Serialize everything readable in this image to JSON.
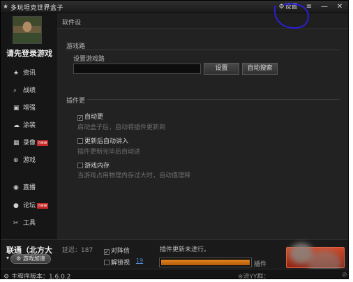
{
  "window": {
    "title": "多玩坦克世界盒子",
    "settings_label": "设置",
    "skin_symbol": "≡",
    "minimize_symbol": "—",
    "close_symbol": "✕"
  },
  "sidebar": {
    "login_text": "请先登录游戏",
    "items": [
      {
        "icon": "star-icon",
        "glyph": "★",
        "label": "资讯",
        "badge": ""
      },
      {
        "icon": "search-icon",
        "glyph": "🔍",
        "label": "战绩",
        "badge": ""
      },
      {
        "icon": "toolbox-icon",
        "glyph": "🧰",
        "label": "增强",
        "badge": ""
      },
      {
        "icon": "tank-icon",
        "glyph": "☁",
        "label": "涂装",
        "badge": ""
      },
      {
        "icon": "film-icon",
        "glyph": "▦",
        "label": "录像",
        "badge": "new"
      },
      {
        "icon": "gamepad-icon",
        "glyph": "🎮",
        "label": "游戏",
        "badge": ""
      },
      {
        "icon": "play-icon",
        "glyph": "▶",
        "label": "直播",
        "badge": ""
      },
      {
        "icon": "chat-icon",
        "glyph": "💬",
        "label": "论坛",
        "badge": "new"
      },
      {
        "icon": "wrench-icon",
        "glyph": "✂",
        "label": "工具",
        "badge": ""
      }
    ]
  },
  "main": {
    "header_title": "软件设",
    "game_path": {
      "section_title": "游戏路",
      "field_label": "设置游戏路",
      "value": "",
      "set_button": "设置",
      "auto_search_button": "自动搜索"
    },
    "plugins": {
      "section_title": "插件更",
      "options": [
        {
          "label": "自动更",
          "checked": true,
          "hint": "启动盒子后，自动将插件更新到"
        },
        {
          "label": "更新后自动讲入",
          "checked": false,
          "hint": "插件更新完毕后自动进"
        },
        {
          "label": "游戏内存",
          "checked": false,
          "hint": "当游戏占用物理内存过大时，自动值理释"
        }
      ]
    }
  },
  "bottom": {
    "server": "联通（北方大",
    "accel_button": "游戏加速",
    "delay_text": "延迟：187",
    "check_teammate": "对阵信",
    "check_unlock_view": "解锁视",
    "link_19": "19",
    "progress_label": "插件更新未进行。",
    "progress_percent": 100,
    "plugin_label": "插件"
  },
  "status": {
    "left": "主程序版本：1.6.0.2",
    "right": "※流YY群："
  },
  "colors": {
    "annotation": "#2a1fd6",
    "progress": "#d9801c",
    "badge": "#c62a2a",
    "start_button": "#b83520"
  }
}
